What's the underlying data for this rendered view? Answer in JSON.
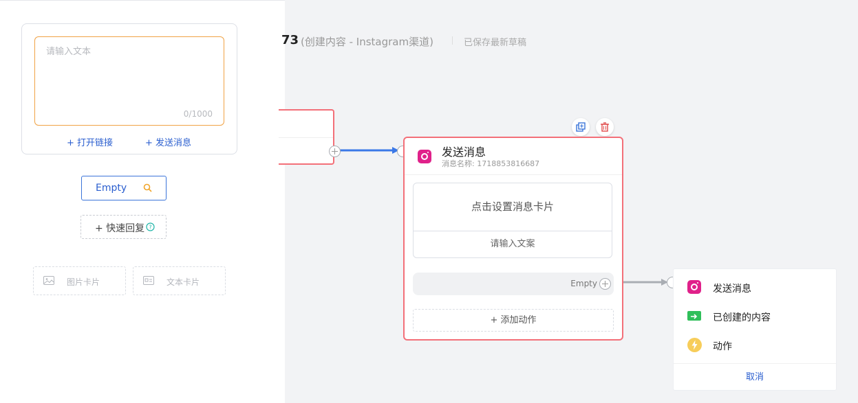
{
  "left_panel": {
    "text_placeholder": "请输入文本",
    "char_counter": "0/1000",
    "open_link_button": "+ 打开链接",
    "send_message_button": "+ 发送消息",
    "empty_button": "Empty",
    "quick_reply_button": "+ 快速回复",
    "image_card": "图片卡片",
    "text_card": "文本卡片"
  },
  "header": {
    "id_fragment": "73",
    "subtitle": "(创建内容 - Instagram渠道)",
    "status": "已保存最新草稿"
  },
  "node": {
    "title": "发送消息",
    "subtitle": "消息名称: 1718853816687",
    "set_card": "点击设置消息卡片",
    "copy_placeholder": "请输入文案",
    "empty_label": "Empty",
    "add_action": "+ 添加动作"
  },
  "menu": {
    "items": [
      {
        "label": "发送消息",
        "icon": "instagram-icon"
      },
      {
        "label": "已创建的内容",
        "icon": "arrow-right-box-icon"
      },
      {
        "label": "动作",
        "icon": "lightning-icon"
      }
    ],
    "cancel": "取消"
  },
  "colors": {
    "accent_blue": "#2a5ecf",
    "node_border": "#f36f78",
    "textarea_border": "#f0a244",
    "instagram_pink": "#e0218a",
    "connector_blue": "#3b78e7"
  }
}
